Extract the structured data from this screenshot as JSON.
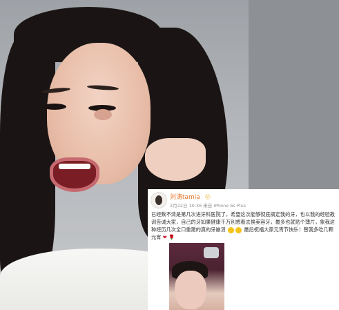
{
  "post": {
    "username": "刘涛tamia",
    "verified_icon": "v-badge-icon",
    "meta": "2月22日 10:36 来自 iPhone 6s Plus",
    "text": "已经数不清是第几次进牙科医院了，希望这次能够彻底搞定我的牙，也以我的经验教训告诫大家，自己的牙如果健康千万别想着去换美容牙，最多也就贴个薄片，象我这种经历几次全口重建的真的牙崩溃",
    "text_tail": "最后祝福大家元宵节快乐！替我多吃几颗元宵",
    "emoji_icon": "grimace-emoji-icon",
    "heart_icon": "heart-icon",
    "rose_icon": "rose-icon"
  },
  "colors": {
    "username": "#e8782a",
    "background_gray": "#8d9196"
  }
}
